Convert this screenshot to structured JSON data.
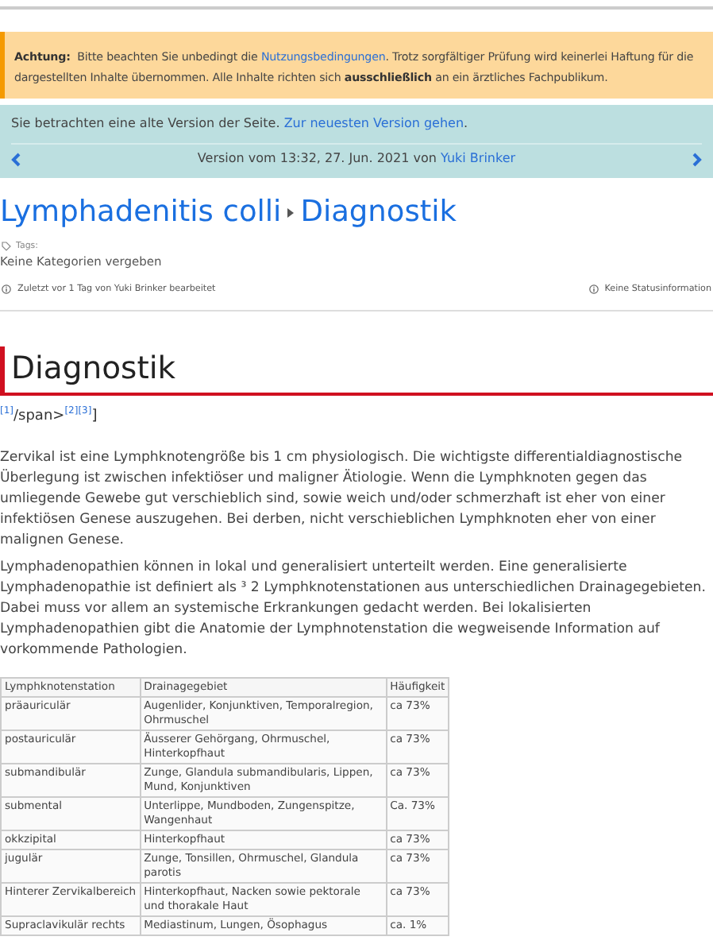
{
  "warning": {
    "label": "Achtung:",
    "text_before": "Bitte beachten Sie unbedingt die",
    "link": "Nutzungsbedingungen",
    "text_after": ". Trotz sorgfältiger Prüfung wird keinerlei Haftung für die dargestellten Inhalte übernommen. Alle Inhalte richten sich **ausschließlich** an ein ärztliches Fachpublikum."
  },
  "old_version": {
    "text": "Sie betrachten eine alte Version der Seite.",
    "link": "Zur neuesten Version gehen",
    "link_end": ".",
    "version_text": "Version vom 13:32, 27. Jun. 2021 von",
    "author": "Yuki Brinker"
  },
  "breadcrumb": [
    "Lymphadenitis colli",
    "Diagnostik"
  ],
  "tags": {
    "label": "Tags:",
    "value": "Keine Kategorien vergeben"
  },
  "meta": {
    "edited": "Zuletzt vor 1 Tag von Yuki Brinker bearbeitet",
    "status": "Keine Statusinformation"
  },
  "section": {
    "heading": "Diagnostik",
    "refs": [
      {
        "kind": "ref",
        "text": "[1]"
      },
      {
        "kind": "text",
        "text": "/span>"
      },
      {
        "kind": "ref",
        "text": "[2]"
      },
      {
        "kind": "ref",
        "text": "[3]"
      },
      {
        "kind": "text",
        "text": "]"
      }
    ],
    "paragraphs": [
      "Zervikal ist eine Lymphknotengröße bis 1 cm physiologisch. Die wichtigste differentialdiagnostische Überlegung ist zwischen infektiöser und maligner Ätiologie.  Wenn die Lymphknoten gegen das umliegende Gewebe gut verschieblich sind, sowie weich und/oder schmerzhaft ist eher von einer infektiösen Genese auszugehen. Bei derben, nicht verschieblichen Lymphknoten eher von einer malignen Genese.",
      "Lymphadenopathien können in lokal und generalisiert unterteilt werden. Eine generalisierte Lymphadenopathie ist definiert als ³ 2 Lymphknotenstationen aus unterschiedlichen Drainagegebieten. Dabei muss vor allem an systemische Erkrankungen gedacht werden. Bei lokalisierten Lymphadenopathien gibt die Anatomie der Lymphnotenstation die wegweisende Information auf vorkommende Pathologien."
    ]
  },
  "table": {
    "columns": [
      "Lymphknotenstation",
      "Drainagegebiet",
      "Häufigkeit"
    ],
    "rows": [
      [
        "präauriculär",
        "Augenlider, Konjunktiven, Temporalregion, Ohrmuschel",
        "ca 73%"
      ],
      [
        "postauriculär",
        "Äusserer Gehörgang, Ohrmuschel, Hinterkopfhaut",
        "ca 73%"
      ],
      [
        "submandibulär",
        "Zunge, Glandula submandibularis, Lippen, Mund, Konjunktiven",
        "ca 73%"
      ],
      [
        "submental",
        "Unterlippe, Mundboden, Zungenspitze, Wangenhaut",
        "Ca. 73%"
      ],
      [
        "okkzipital",
        "Hinterkopfhaut",
        "ca 73%"
      ],
      [
        "jugulär",
        "Zunge, Tonsillen, Ohrmuschel, Glandula parotis",
        "ca 73%"
      ],
      [
        "Hinterer Zervikalbereich",
        "Hinterkopfhaut, Nacken sowie pektorale und thorakale Haut",
        "ca 73%"
      ],
      [
        "Supraclavikulär rechts",
        "Mediastinum, Lungen, Ösophagus",
        "ca. 1%"
      ]
    ]
  }
}
